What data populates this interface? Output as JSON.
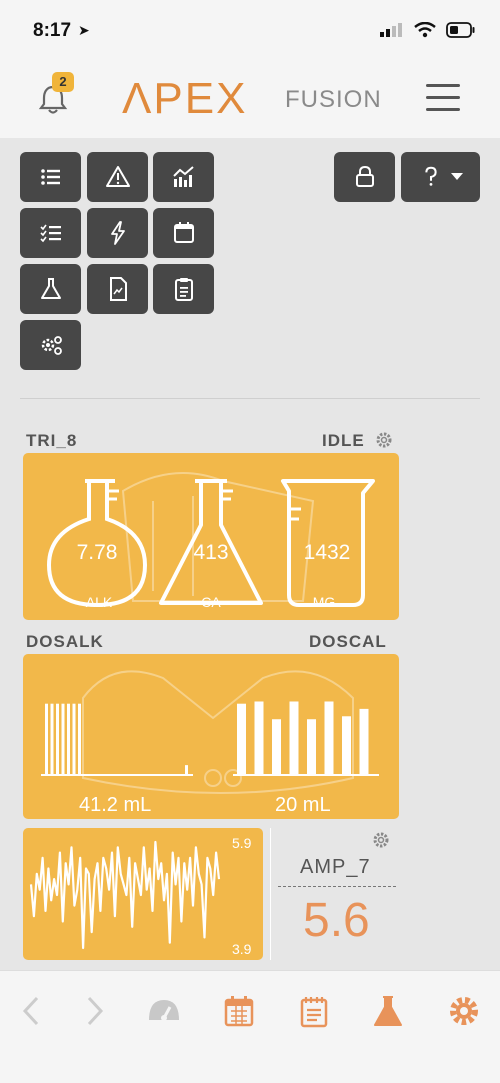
{
  "status_bar": {
    "time": "8:17"
  },
  "header": {
    "notification_count": "2",
    "logo_main": "ΛPEX",
    "logo_sub": "FUSION"
  },
  "toolbar": {
    "buttons": [
      {
        "name": "list-button",
        "icon": "list-icon"
      },
      {
        "name": "alerts-button",
        "icon": "warning-icon"
      },
      {
        "name": "graph-button",
        "icon": "chart-icon"
      },
      {
        "name": "tasks-button",
        "icon": "checklist-icon"
      },
      {
        "name": "power-button",
        "icon": "lightning-icon"
      },
      {
        "name": "calendar-button",
        "icon": "calendar-icon"
      },
      {
        "name": "measurements-button",
        "icon": "flask-icon"
      },
      {
        "name": "documents-button",
        "icon": "document-icon"
      },
      {
        "name": "clipboard-button",
        "icon": "clipboard-icon"
      },
      {
        "name": "settings-button",
        "icon": "gears-icon"
      },
      {
        "name": "lock-button",
        "icon": "lock-icon"
      },
      {
        "name": "help-button",
        "icon": "help-icon"
      }
    ]
  },
  "trident": {
    "name": "TRI_8",
    "status": "IDLE",
    "readings": [
      {
        "label": "ALK",
        "value": "7.78"
      },
      {
        "label": "CA",
        "value": "413"
      },
      {
        "label": "MG",
        "value": "1432"
      }
    ]
  },
  "dosing": {
    "left_name": "DOSALK",
    "right_name": "DOSCAL",
    "left_value": "41.2 mL",
    "right_value": "20 mL",
    "left_bars": [
      0.95,
      0.95,
      0.95,
      0.95,
      0.95,
      0.95,
      0.95,
      0.12
    ],
    "right_bars": [
      0.95,
      0.98,
      0.74,
      0.98,
      0.74,
      0.98,
      0.78,
      0.88
    ]
  },
  "amp": {
    "name": "AMP_7",
    "value": "5.6",
    "trend_max": "5.9",
    "trend_min": "3.9",
    "trend": [
      5.1,
      4.5,
      5.3,
      5.0,
      5.6,
      4.6,
      5.4,
      4.8,
      5.2,
      4.9,
      5.7,
      4.4,
      5.5,
      5.1,
      5.8,
      4.7,
      5.0,
      5.6,
      3.9,
      5.4,
      5.3,
      4.2,
      5.2,
      5.5,
      4.6,
      5.6,
      5.4,
      5.0,
      5.7,
      4.5,
      5.8,
      5.3,
      5.1,
      4.9,
      5.6,
      4.3,
      5.5,
      5.2,
      4.9,
      5.8,
      5.0,
      5.4,
      4.6,
      5.9,
      5.2,
      5.5,
      4.8,
      5.3,
      4.0,
      5.7,
      5.1,
      5.6,
      4.4,
      5.5,
      5.0,
      5.6,
      4.7,
      5.8,
      5.3,
      5.1,
      4.1,
      5.6,
      5.4,
      4.9,
      5.7,
      5.2
    ]
  },
  "colors": {
    "accent": "#e8935a",
    "widget": "#f2b84a",
    "button": "#474747"
  }
}
